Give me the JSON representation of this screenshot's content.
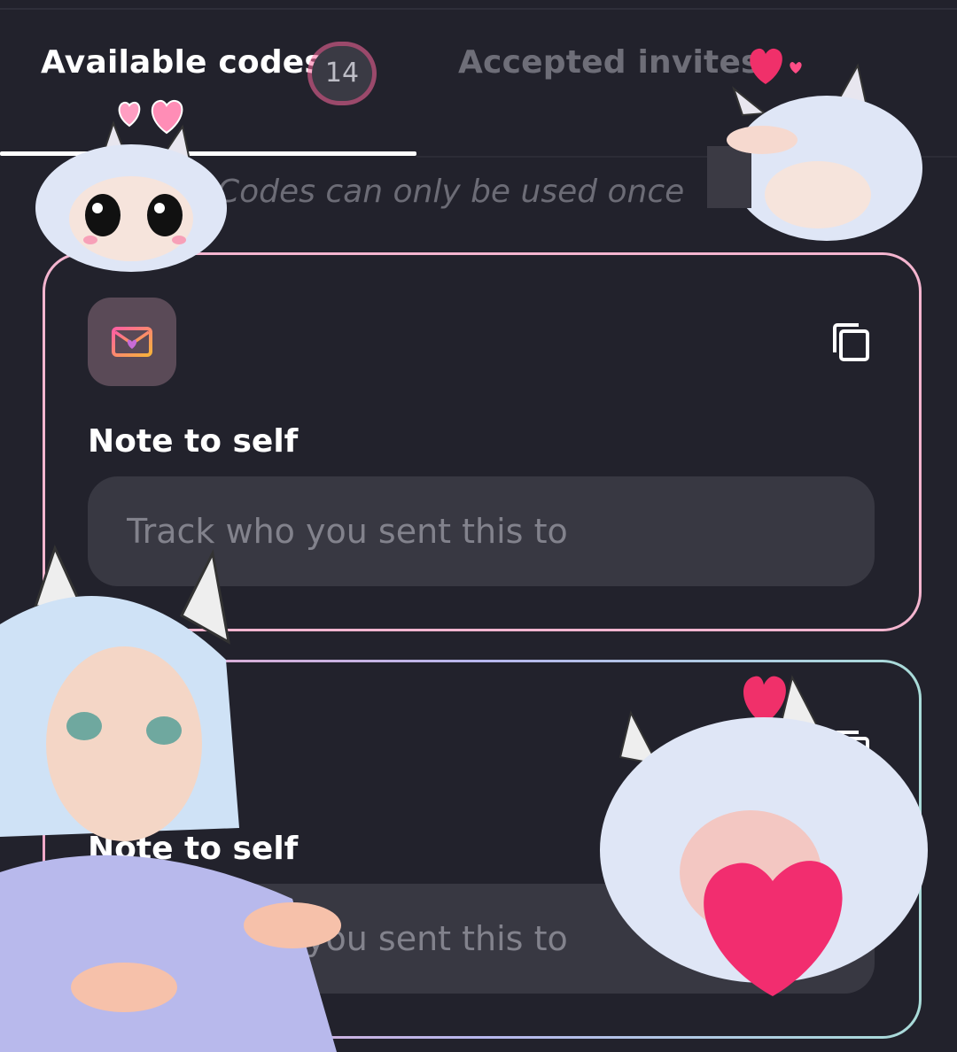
{
  "tabs": {
    "available": {
      "label": "Available codes",
      "count": "14"
    },
    "accepted": {
      "label": "Accepted invites"
    }
  },
  "notice": "Codes can only be used once",
  "cards": [
    {
      "note_label": "Note to self",
      "note_placeholder": "Track who you sent this to"
    },
    {
      "note_label": "Note to self",
      "note_placeholder": "Track who you sent this to"
    }
  ],
  "colors": {
    "background": "#22222c",
    "card1_border": "#f4b5cf",
    "input_bg": "#383842",
    "accent_pink": "#ff5fa2"
  },
  "icons": {
    "envelope": "envelope-heart-icon",
    "copy": "copy-icon"
  }
}
